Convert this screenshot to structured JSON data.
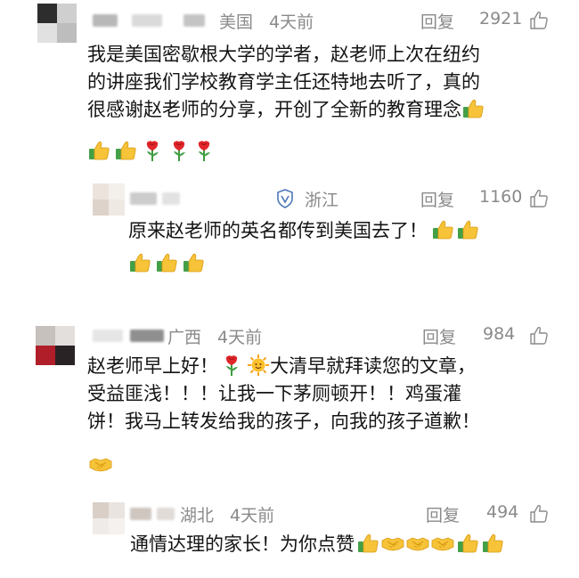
{
  "comments": [
    {
      "region": "美国",
      "time": "4天前",
      "reply": "回复",
      "likes": "2921",
      "lines": [
        "我是美国密歇根大学的学者，赵老师上次在纽约",
        "的讲座我们学校教育学主任还特地去听了，真的",
        "很感谢赵老师的分享，开创了全新的教育理念"
      ],
      "emojis_inline": [
        "thumbs-up"
      ],
      "emojis_row": [
        "thumbs-up",
        "thumbs-up",
        "rose",
        "rose",
        "rose"
      ]
    },
    {
      "region": "浙江",
      "time": "",
      "reply": "回复",
      "likes": "1160",
      "badge": "vip-shield-icon",
      "lines": [
        "原来赵老师的英名都传到美国去了！"
      ],
      "emojis_inline": [
        "thumbs-up",
        "thumbs-up"
      ],
      "emojis_row": [
        "thumbs-up",
        "thumbs-up",
        "thumbs-up"
      ]
    },
    {
      "region": "广西",
      "time": "4天前",
      "reply": "回复",
      "likes": "984",
      "lines": [
        "赵老师早上好！",
        "大清早就拜读您的文章，",
        "受益匪浅！！！让我一下茅厕顿开！！鸡蛋灌",
        "饼！我马上转发给我的孩子，向我的孩子道歉！"
      ],
      "emojis_inline": [
        "rose",
        "sun"
      ],
      "emojis_row": [
        "handshake"
      ]
    },
    {
      "region": "湖北",
      "time": "4天前",
      "reply": "回复",
      "likes": "494",
      "lines": [
        "通情达理的家长！为你点赞"
      ],
      "emojis_inline": [
        "thumbs-up",
        "handshake",
        "handshake",
        "handshake",
        "thumbs-up",
        "thumbs-up"
      ],
      "emojis_row": []
    }
  ],
  "colors": {
    "meta_gray": "#8a8a8a",
    "text": "#141414",
    "thumb_yellow": "#f5c43a",
    "cuff_green": "#4caf50",
    "rose_red": "#e0262b",
    "sun_orange": "#f7a21b"
  }
}
